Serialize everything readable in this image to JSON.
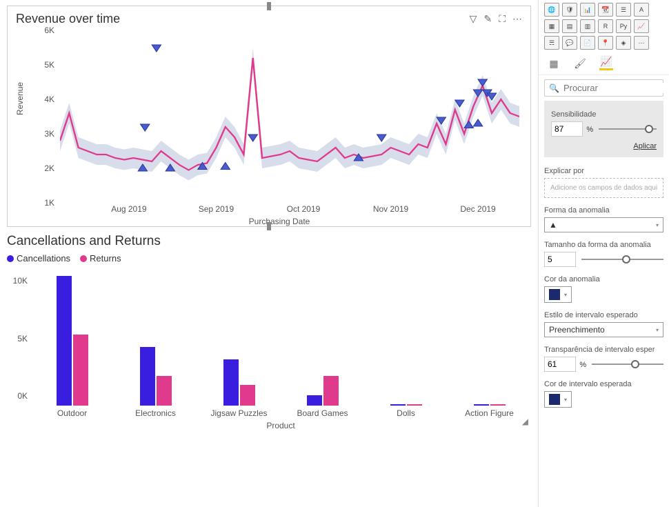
{
  "chart_data": [
    {
      "type": "line",
      "title": "Revenue over time",
      "xlabel": "Purchasing Date",
      "ylabel": "Revenue",
      "ylim": [
        1000,
        6000
      ],
      "yticks": [
        "1K",
        "2K",
        "3K",
        "4K",
        "5K",
        "6K"
      ],
      "xticks": [
        "Aug 2019",
        "Sep 2019",
        "Oct 2019",
        "Nov 2019",
        "Dec 2019"
      ],
      "x": [
        0,
        2,
        4,
        6,
        8,
        10,
        12,
        14,
        16,
        18,
        20,
        22,
        24,
        26,
        28,
        30,
        32,
        34,
        36,
        38,
        40,
        42,
        44,
        46,
        48,
        50,
        52,
        54,
        56,
        58,
        60,
        62,
        64,
        66,
        68,
        70,
        72,
        74,
        76,
        78,
        80,
        82,
        84,
        86,
        88,
        90,
        92,
        94,
        96,
        98,
        100
      ],
      "values": [
        2800,
        3600,
        2600,
        2500,
        2400,
        2400,
        2300,
        2250,
        2300,
        2250,
        2200,
        2500,
        2300,
        2100,
        1950,
        2100,
        2150,
        2600,
        3200,
        2900,
        2400,
        5200,
        2300,
        2350,
        2400,
        2500,
        2300,
        2250,
        2200,
        2400,
        2600,
        2300,
        2400,
        2300,
        2350,
        2400,
        2600,
        2500,
        2400,
        2700,
        2600,
        3300,
        2700,
        3700,
        3000,
        3800,
        4400,
        3600,
        4000,
        3600,
        3500
      ],
      "anomalies_up": [
        {
          "x": 18.5,
          "y": 3200
        },
        {
          "x": 21,
          "y": 5500
        },
        {
          "x": 42,
          "y": 2900
        },
        {
          "x": 70,
          "y": 2900
        },
        {
          "x": 83,
          "y": 3400
        },
        {
          "x": 87,
          "y": 3900
        },
        {
          "x": 91,
          "y": 4200
        },
        {
          "x": 92,
          "y": 4500
        },
        {
          "x": 93,
          "y": 4200
        },
        {
          "x": 94,
          "y": 4100
        }
      ],
      "anomalies_down": [
        {
          "x": 18,
          "y": 2000
        },
        {
          "x": 24,
          "y": 2000
        },
        {
          "x": 31,
          "y": 2050
        },
        {
          "x": 36,
          "y": 2050
        },
        {
          "x": 65,
          "y": 2300
        },
        {
          "x": 89,
          "y": 3250
        },
        {
          "x": 91,
          "y": 3300
        }
      ],
      "band_delta": 300
    },
    {
      "type": "bar",
      "title": "Cancellations and Returns",
      "xlabel": "Product",
      "ylabel": "",
      "ylim": [
        0,
        12000
      ],
      "yticks": [
        "0K",
        "5K",
        "10K"
      ],
      "categories": [
        "Outdoor",
        "Electronics",
        "Jigsaw Puzzles",
        "Board Games",
        "Dolls",
        "Action Figure"
      ],
      "series": [
        {
          "name": "Cancellations",
          "color": "#3a1ee0",
          "values": [
            11300,
            5100,
            4000,
            900,
            100,
            100
          ]
        },
        {
          "name": "Returns",
          "color": "#e03a8c",
          "values": [
            6200,
            2600,
            1800,
            2600,
            100,
            100
          ]
        }
      ]
    }
  ],
  "chart1_actions": {
    "filter": "▽",
    "sort": "✎",
    "focus": "⛶",
    "more": "⋯"
  },
  "panel": {
    "search_placeholder": "Procurar",
    "sensibilidade_label": "Sensibilidade",
    "sensibilidade_value": "87",
    "percent": "%",
    "aplicar": "Aplicar",
    "explicar_por": "Explicar por",
    "explicar_placeholder": "Adicione os campos de dados aqui",
    "forma_label": "Forma da anomalia",
    "forma_value": "▲",
    "tamanho_label": "Tamanho da forma da anomalia",
    "tamanho_value": "5",
    "cor_label": "Cor da anomalia",
    "cor_value": "#1a2a6c",
    "estilo_label": "Estilo de intervalo esperado",
    "estilo_value": "Preenchimento",
    "transp_label": "Transparência de intervalo esper",
    "transp_value": "61",
    "cor_intervalo_label": "Cor de intervalo esperada",
    "cor_intervalo_value": "#1a2a6c"
  },
  "viz_icons_count": 21
}
